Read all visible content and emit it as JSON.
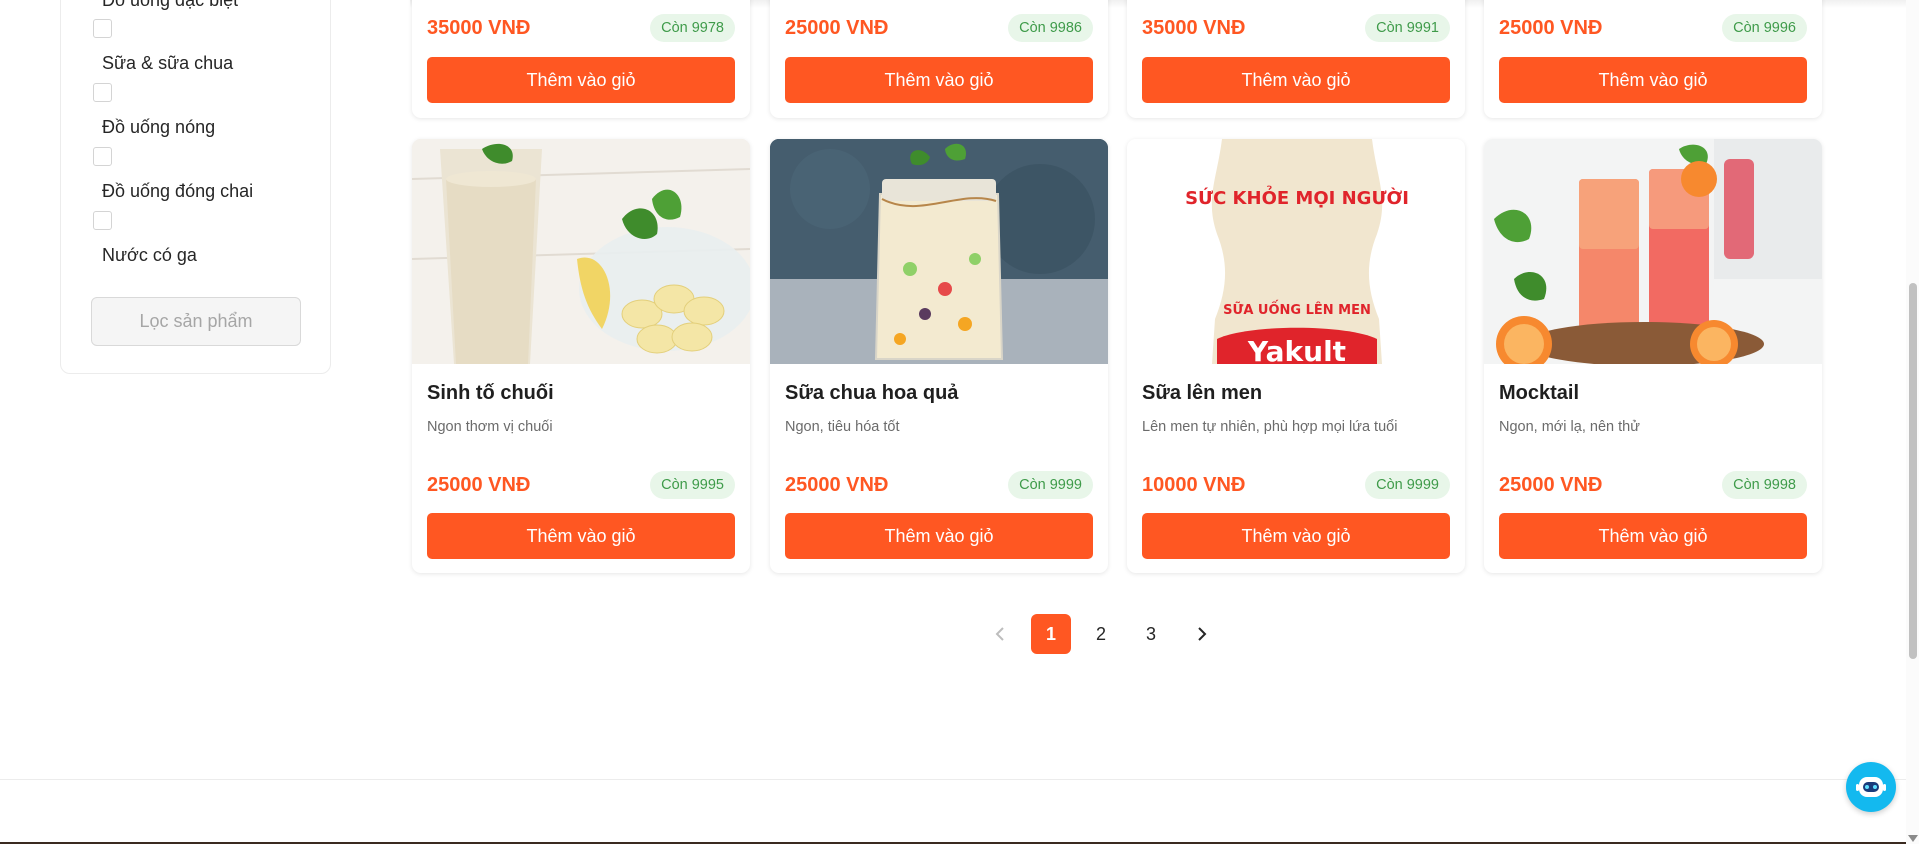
{
  "filters": {
    "categories": [
      {
        "label": "Đồ uống đặc biệt",
        "checked": false
      },
      {
        "label": "Sữa & sữa chua",
        "checked": false
      },
      {
        "label": "Đồ uống nóng",
        "checked": false
      },
      {
        "label": "Đồ uống đóng chai",
        "checked": false
      },
      {
        "label": "Nước có ga",
        "checked": false
      }
    ],
    "apply_button": "Lọc sản phẩm"
  },
  "products_top_row": [
    {
      "price": "35000 VNĐ",
      "stock": "Còn 9978",
      "button": "Thêm vào giỏ"
    },
    {
      "price": "25000 VNĐ",
      "stock": "Còn 9986",
      "button": "Thêm vào giỏ"
    },
    {
      "price": "35000 VNĐ",
      "stock": "Còn 9991",
      "button": "Thêm vào giỏ"
    },
    {
      "price": "25000 VNĐ",
      "stock": "Còn 9996",
      "button": "Thêm vào giỏ"
    }
  ],
  "products": [
    {
      "name": "Sinh tố chuối",
      "description": "Ngon thơm vị chuối",
      "price": "25000 VNĐ",
      "stock": "Còn 9995",
      "button": "Thêm vào giỏ"
    },
    {
      "name": "Sữa chua hoa quả",
      "description": "Ngon, tiêu hóa tốt",
      "price": "25000 VNĐ",
      "stock": "Còn 9999",
      "button": "Thêm vào giỏ"
    },
    {
      "name": "Sữa lên men",
      "description": "Lên men tự nhiên, phù hợp mọi lứa tuổi",
      "price": "10000 VNĐ",
      "stock": "Còn 9999",
      "button": "Thêm vào giỏ",
      "image_text": {
        "top": "SỨC KHỎE MỌI NGƯỜI",
        "middle": "SỮA UỐNG LÊN MEN",
        "brand": "Yakult"
      }
    },
    {
      "name": "Mocktail",
      "description": "Ngon, mới lạ, nên thử",
      "price": "25000 VNĐ",
      "stock": "Còn 9998",
      "button": "Thêm vào giỏ"
    }
  ],
  "pagination": {
    "prev_icon": "chevron-left-icon",
    "next_icon": "chevron-right-icon",
    "pages": [
      "1",
      "2",
      "3"
    ],
    "current": 1
  },
  "chat_widget": {
    "icon": "chatbot-icon"
  },
  "colors": {
    "accent": "#ff5722",
    "stock_bg": "#e8f6e9",
    "stock_text": "#3f9b4a",
    "chat": "#13b9ef"
  }
}
